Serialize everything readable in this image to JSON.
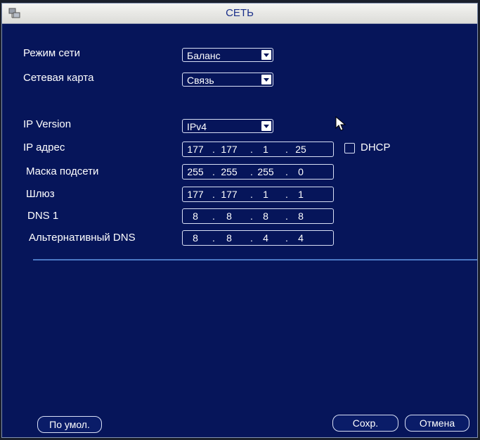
{
  "window": {
    "title": "СЕТЬ"
  },
  "form": {
    "network_mode_label": "Режим сети",
    "network_mode_value": "Баланс",
    "network_card_label": "Сетевая карта",
    "network_card_value": "Связь",
    "ip_version_label": "IP Version",
    "ip_version_value": "IPv4",
    "ip_label": "IP адрес",
    "ip": [
      "177",
      "177",
      "1",
      "25"
    ],
    "dhcp_label": "DHCP",
    "dhcp_checked": false,
    "mask_label": "Маска подсети",
    "mask": [
      "255",
      "255",
      "255",
      "0"
    ],
    "gateway_label": "Шлюз",
    "gateway": [
      "177",
      "177",
      "1",
      "1"
    ],
    "dns1_label": "DNS 1",
    "dns1": [
      "8",
      "8",
      "8",
      "8"
    ],
    "dns2_label": "Альтернативный DNS",
    "dns2": [
      "8",
      "8",
      "4",
      "4"
    ]
  },
  "buttons": {
    "default_label": "По умол.",
    "save_label": "Сохр.",
    "cancel_label": "Отмена"
  },
  "colors": {
    "background": "#06155a",
    "title_bar": "#e8e8e6",
    "title_text": "#1a2f8a",
    "border": "#d8dff5",
    "separator": "#4a78c4"
  }
}
